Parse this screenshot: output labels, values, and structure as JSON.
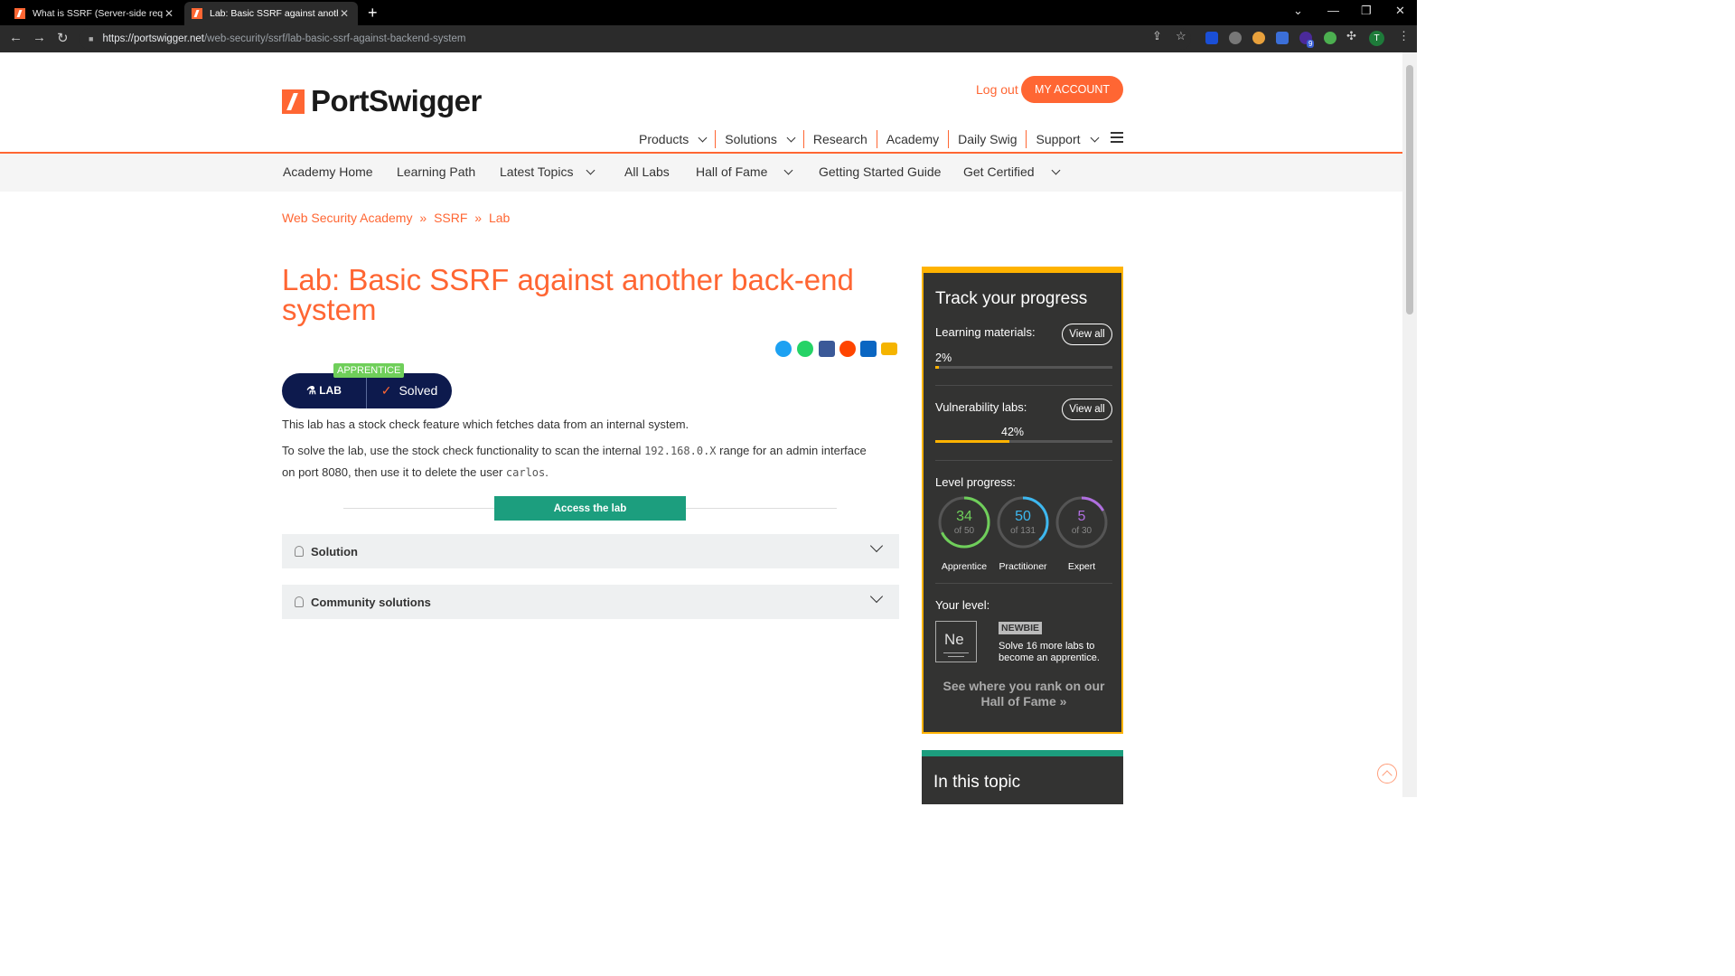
{
  "browser": {
    "tabs": [
      {
        "title": "What is SSRF (Server-side reques"
      },
      {
        "title": "Lab: Basic SSRF against another b"
      }
    ],
    "new_tab": "+",
    "url_host": "https://portswigger.net",
    "url_path": "/web-security/ssrf/lab-basic-ssrf-against-backend-system",
    "profile_initial": "T",
    "extension_badge": "9"
  },
  "header": {
    "logo_text": "PortSwigger",
    "logout": "Log out",
    "my_account": "MY ACCOUNT",
    "nav": [
      {
        "label": "Products"
      },
      {
        "label": "Solutions"
      },
      {
        "label": "Research"
      },
      {
        "label": "Academy"
      },
      {
        "label": "Daily Swig"
      },
      {
        "label": "Support"
      }
    ]
  },
  "subnav": [
    "Academy Home",
    "Learning Path",
    "Latest Topics",
    "All Labs",
    "Hall of Fame",
    "Getting Started Guide",
    "Get Certified"
  ],
  "breadcrumb": [
    "Web Security Academy",
    "SSRF",
    "Lab"
  ],
  "breadcrumb_sep": "»",
  "lab": {
    "title": "Lab: Basic SSRF against another back-end system",
    "level_badge": "APPRENTICE",
    "lab_label": "LAB",
    "status": "Solved",
    "intro": "This lab has a stock check feature which fetches data from an internal system.",
    "solve_1": "To solve the lab, use the stock check functionality to scan the internal ",
    "solve_ip": "192.168.0.X",
    "solve_2": " range for an admin interface",
    "solve_3": "on port 8080, then use it to delete the user ",
    "solve_user": "carlos",
    "solve_4": ".",
    "access_button": "Access the lab",
    "accordions": [
      "Solution",
      "Community solutions"
    ]
  },
  "sidebar": {
    "title": "Track your progress",
    "learning_label": "Learning materials:",
    "learning_pct": "2%",
    "learning_fill": 0.02,
    "vuln_label": "Vulnerability labs:",
    "vuln_pct": "42%",
    "vuln_fill": 0.42,
    "view_all": "View all",
    "level_label": "Level progress:",
    "levels": [
      {
        "num": "34",
        "of": "of 50",
        "name": "Apprentice",
        "color": "#6fcf5a",
        "fraction": 0.68
      },
      {
        "num": "50",
        "of": "of 131",
        "name": "Practitioner",
        "color": "#3db8f0",
        "fraction": 0.38
      },
      {
        "num": "5",
        "of": "of 30",
        "name": "Expert",
        "color": "#b06fe0",
        "fraction": 0.17
      }
    ],
    "your_level_label": "Your level:",
    "element_symbol": "Ne",
    "level_name": "NEWBIE",
    "level_hint": "Solve 16 more labs to become an apprentice.",
    "rank_text": "See where you rank on our Hall of Fame",
    "rank_arrow": "»",
    "topic_title": "In this topic"
  },
  "colors": {
    "accent": "#ff6633",
    "green": "#1c9e7e",
    "gold": "#ffb300",
    "navy": "#0d1a4d"
  }
}
